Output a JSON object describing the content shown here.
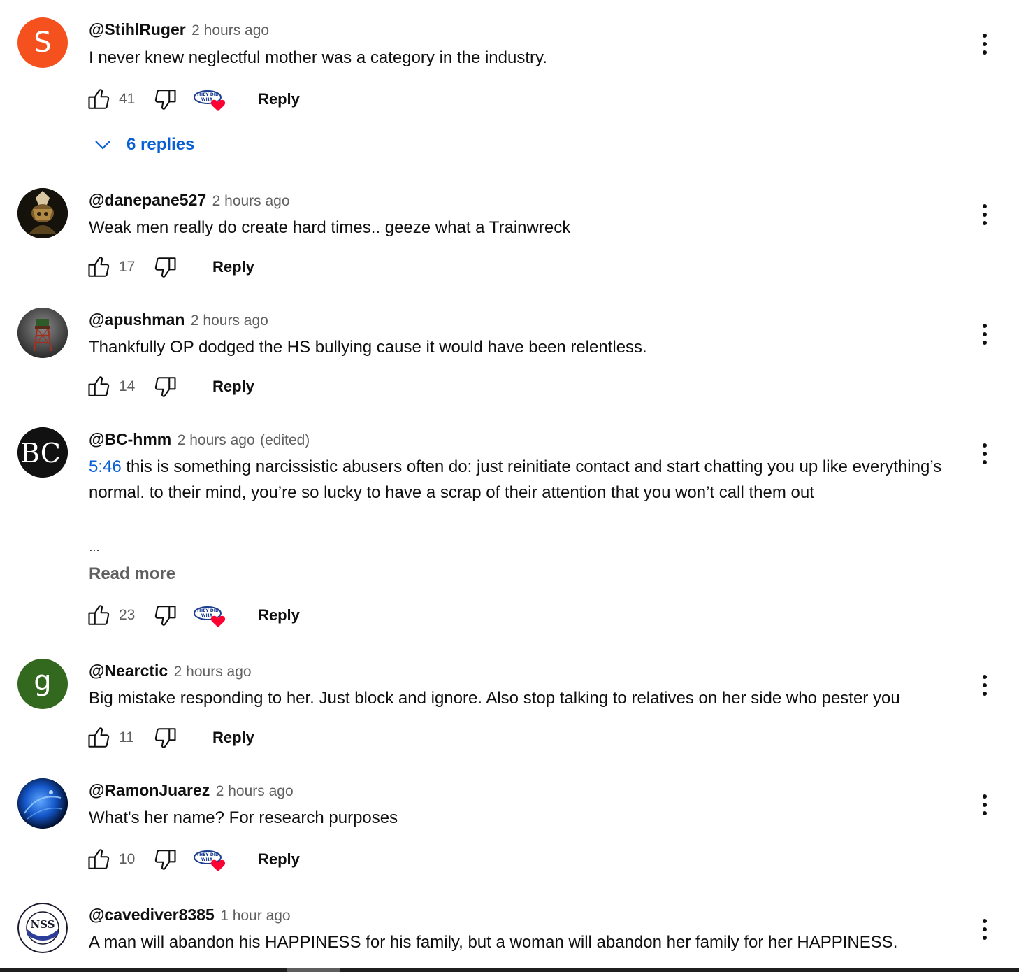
{
  "comments": [
    {
      "author": "@StihlRuger",
      "time": "2 hours ago",
      "text": "I never knew neglectful mother was a category in the industry.",
      "likes": "41",
      "reply_label": "Reply",
      "creator_heart": true,
      "heart_badge_text": "THEY DID WHA",
      "avatar_letter": "S",
      "avatar_color": "#f4511e",
      "replies_label": "6 replies"
    },
    {
      "author": "@danepane527",
      "time": "2 hours ago",
      "text": "Weak men really do create hard times.. geeze what a Trainwreck",
      "likes": "17",
      "reply_label": "Reply",
      "creator_heart": false
    },
    {
      "author": "@apushman",
      "time": "2 hours ago",
      "text": "Thankfully OP dodged the HS bullying cause it would have been relentless.",
      "likes": "14",
      "reply_label": "Reply",
      "creator_heart": false
    },
    {
      "author": "@BC-hmm",
      "time": "2 hours ago",
      "edited": "(edited)",
      "timestamp_link": "5:46",
      "text": " this is something narcissistic abusers often do: just reinitiate contact and start chatting you up like everything’s normal.  to their mind, you’re so lucky to have a scrap of their attention that you won’t call them out",
      "ellipsis": "…",
      "read_more": "Read more",
      "likes": "23",
      "reply_label": "Reply",
      "creator_heart": true,
      "heart_badge_text": "THEY DID WHA",
      "avatar_letters": "BC"
    },
    {
      "author": "@Nearctic",
      "time": "2 hours ago",
      "text": "Big mistake responding to her. Just block and ignore. Also stop talking to relatives on her side who pester you",
      "likes": "11",
      "reply_label": "Reply",
      "creator_heart": false,
      "avatar_letter": "g",
      "avatar_color": "#33691e"
    },
    {
      "author": "@RamonJuarez",
      "time": "2 hours ago",
      "text": "What's her name? For research purposes",
      "likes": "10",
      "reply_label": "Reply",
      "creator_heart": true,
      "heart_badge_text": "THEY DID WHA"
    },
    {
      "author": "@cavediver8385",
      "time": "1 hour ago",
      "text": "A man will abandon his HAPPINESS for his family, but a woman will abandon her family for her HAPPINESS.",
      "avatar_logo_text": "NSS"
    }
  ],
  "colors": {
    "link_blue": "#065fd4",
    "secondary_text": "#606060",
    "heart_red": "#ff0033"
  },
  "icons": {
    "like": "thumbs-up-icon",
    "dislike": "thumbs-down-icon",
    "creator_heart": "creator-heart-icon",
    "menu": "more-vert-icon",
    "expand": "chevron-down-icon"
  }
}
